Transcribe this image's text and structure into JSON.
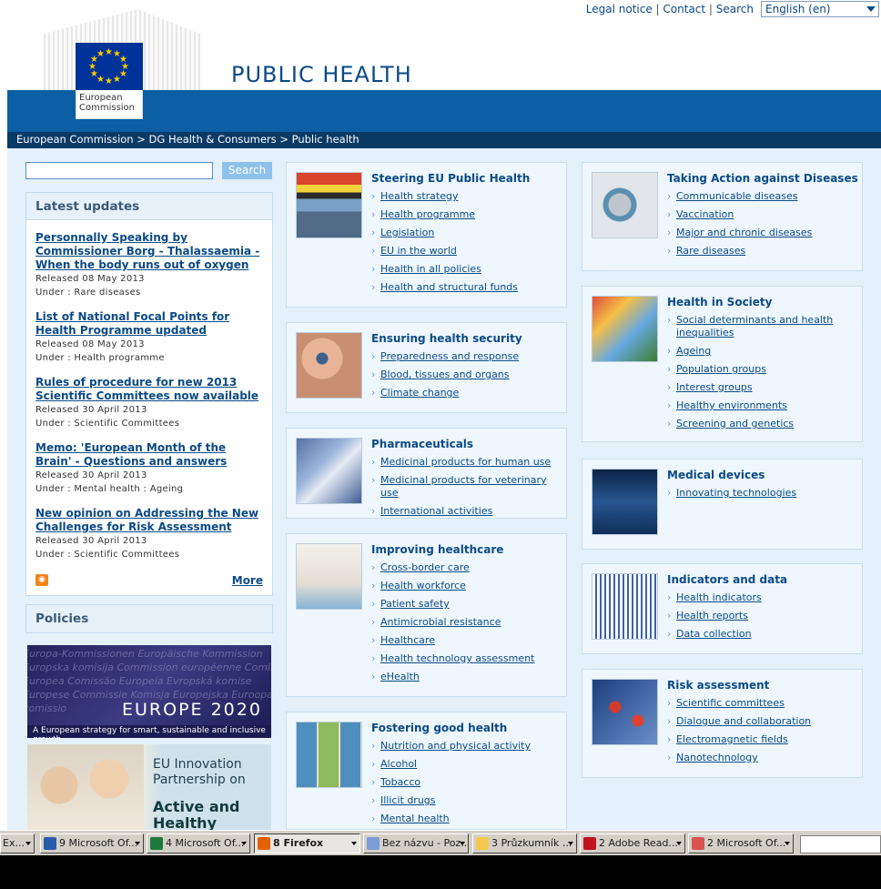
{
  "header": {
    "legal_notice": "Legal notice",
    "contact": "Contact",
    "search": "Search",
    "language": "English (en)",
    "logo_text": "European Commission",
    "site_title": "PUBLIC HEALTH"
  },
  "breadcrumb": "European Commission > DG Health & Consumers > Public health",
  "search": {
    "button": "Search",
    "value": ""
  },
  "latest": {
    "heading": "Latest updates",
    "items": [
      {
        "title": "Personnally Speaking by Commissioner Borg - Thalassaemia - When the body runs out of oxygen",
        "released": "Released 08 May 2013",
        "under": "Under : Rare diseases"
      },
      {
        "title": "List of National Focal Points for Health Programme updated",
        "released": "Released 08 May 2013",
        "under": "Under : Health programme"
      },
      {
        "title": "Rules of procedure for new 2013 Scientific Committees now available",
        "released": "Released 30 April 2013",
        "under": "Under : Scientific Committees"
      },
      {
        "title": "Memo: 'European Month of the Brain' - Questions and answers",
        "released": "Released 30 April 2013",
        "under": "Under : Mental health : Ageing"
      },
      {
        "title": "New opinion on Addressing the New Challenges for Risk Assessment",
        "released": "Released 30 April 2013",
        "under": "Under : Scientific Committees"
      }
    ],
    "more": "More"
  },
  "policies": {
    "heading": "Policies"
  },
  "europe2020": {
    "title": "EUROPE 2020",
    "subtitle": "A European strategy for smart, sustainable and inclusive growth",
    "bg": "Europa-Kommissionen Europäische Kommission Europska komisija Commission européenne Comisión Europea Comissão Europeia Evropská komise Europese Commissie Komisja Europejska Euroopan komissio"
  },
  "eip": {
    "line1": "EU Innovation Partnership on",
    "line2": "Active and Healthy Ageing"
  },
  "cards_mid": [
    {
      "title": "Steering EU Public Health",
      "links": [
        "Health strategy",
        "Health programme",
        "Legislation",
        "EU in the world",
        "Health in all policies",
        "Health and structural funds"
      ]
    },
    {
      "title": "Ensuring health security",
      "links": [
        "Preparedness and response",
        "Blood, tissues and organs",
        "Climate change"
      ]
    },
    {
      "title": "Pharmaceuticals",
      "links": [
        "Medicinal products for human use",
        "Medicinal products for veterinary use",
        "International activities"
      ]
    },
    {
      "title": "Improving healthcare",
      "links": [
        "Cross-border care",
        "Health workforce",
        "Patient safety",
        "Antimicrobial resistance",
        "Healthcare",
        "Health technology assessment",
        "eHealth"
      ]
    },
    {
      "title": "Fostering good health",
      "links": [
        "Nutrition and physical activity",
        "Alcohol",
        "Tobacco",
        "Illicit drugs",
        "Mental health"
      ]
    }
  ],
  "cards_right": [
    {
      "title": "Taking Action against Diseases",
      "links": [
        "Communicable diseases",
        "Vaccination",
        "Major and chronic diseases",
        "Rare diseases"
      ]
    },
    {
      "title": "Health in Society",
      "links": [
        "Social determinants and health inequalities",
        "Ageing",
        "Population groups",
        "Interest groups",
        "Healthy environments",
        "Screening and genetics"
      ]
    },
    {
      "title": "Medical devices",
      "links": [
        "Innovating technologies"
      ]
    },
    {
      "title": "Indicators and data",
      "links": [
        "Health indicators",
        "Health reports",
        "Data collection"
      ]
    },
    {
      "title": "Risk assessment",
      "links": [
        "Scientific committees",
        "Dialogue and collaboration",
        "Electromagnetic fields",
        "Nanotechnology"
      ]
    }
  ],
  "taskbar": [
    {
      "label": "Ex...",
      "icon": "generic-icon"
    },
    {
      "label": "9 Microsoft Of...",
      "icon": "word-icon"
    },
    {
      "label": "4 Microsoft Of...",
      "icon": "excel-icon"
    },
    {
      "label": "8 Firefox",
      "icon": "firefox-icon"
    },
    {
      "label": "Bez názvu - Poz...",
      "icon": "paint-icon"
    },
    {
      "label": "3 Průzkumník ...",
      "icon": "folder-icon"
    },
    {
      "label": "2 Adobe Read...",
      "icon": "pdf-icon"
    },
    {
      "label": "2 Microsoft Of...",
      "icon": "office-icon"
    }
  ],
  "colors": {
    "brand_blue": "#0b5fa5",
    "dark_blue": "#0a3a66",
    "link": "#0b4a86",
    "bg_light": "#e4f1fb"
  }
}
